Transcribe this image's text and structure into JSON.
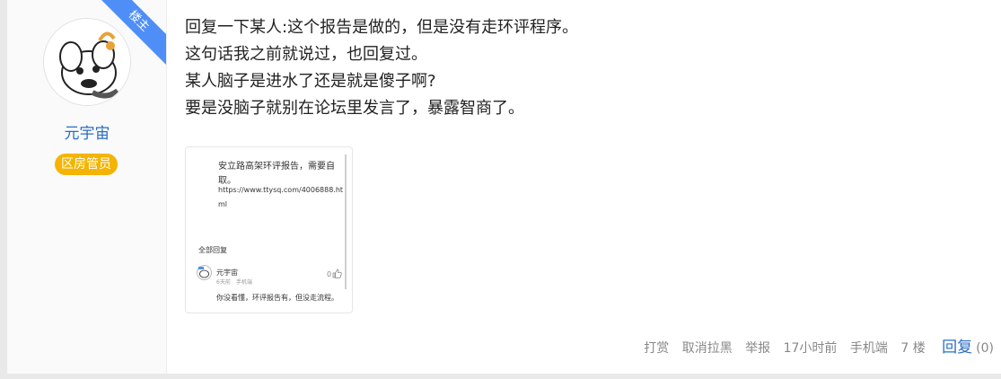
{
  "user": {
    "ribbon": "楼主",
    "name": "元宇宙",
    "badge": "区房管员"
  },
  "post": {
    "lines": [
      "回复一下某人:这个报告是做的，但是没有走环评程序。",
      "这句话我之前就说过，也回复过。",
      "某人脑子是进水了还是就是傻子啊?",
      "要是没脑子就别在论坛里发言了，暴露智商了。"
    ]
  },
  "screenshot": {
    "text1": "安立路高架环评报告，需要自",
    "text2": "取。",
    "text3": "https://www.ttysq.com/4006888.ht",
    "text4": "ml",
    "all_replies": "全部回复",
    "reply_user": "元宇宙",
    "reply_meta_time": "6天前",
    "reply_meta_device": "手机端",
    "like_count": "0",
    "reply_text": "你没看懂，环评报告有，但没走流程。"
  },
  "footer": {
    "tip": "打赏",
    "unblock": "取消拉黑",
    "report": "举报",
    "time": "17小时前",
    "device": "手机端",
    "floor": "7 楼",
    "reply": "回复",
    "reply_count": "(0)"
  }
}
